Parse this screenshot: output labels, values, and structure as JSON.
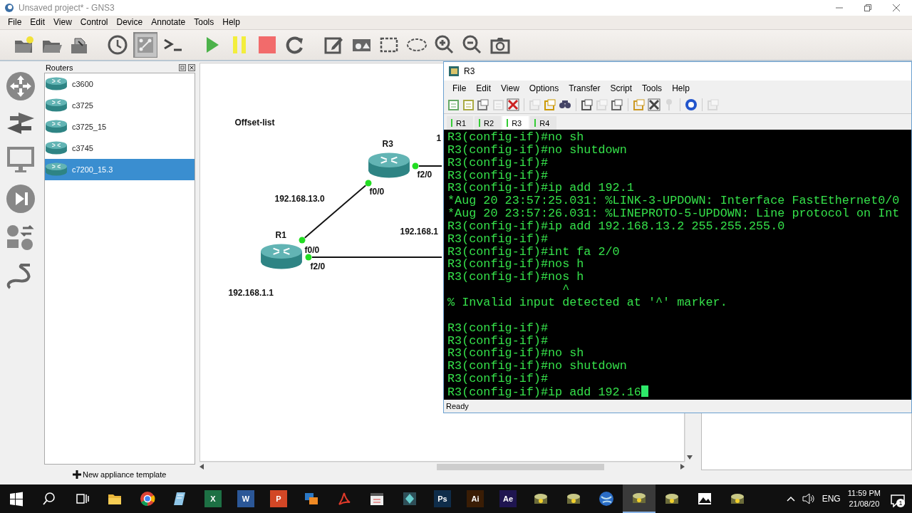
{
  "window": {
    "title": "Unsaved project* - GNS3"
  },
  "menu": [
    "File",
    "Edit",
    "View",
    "Control",
    "Device",
    "Annotate",
    "Tools",
    "Help"
  ],
  "toolbar": [
    {
      "kind": "new-project",
      "on": false
    },
    {
      "kind": "open-project",
      "on": false
    },
    {
      "kind": "save-project",
      "on": false
    },
    {
      "kind": "snapshot",
      "on": false
    },
    {
      "kind": "labels",
      "on": true
    },
    {
      "kind": "console",
      "on": false
    },
    {
      "kind": "start",
      "on": false
    },
    {
      "kind": "suspend",
      "on": false
    },
    {
      "kind": "stop",
      "on": false
    },
    {
      "kind": "reload",
      "on": false
    },
    {
      "kind": "note",
      "on": false
    },
    {
      "kind": "image",
      "on": false
    },
    {
      "kind": "rectangle",
      "on": false
    },
    {
      "kind": "ellipse",
      "on": false
    },
    {
      "kind": "zoom-in",
      "on": false
    },
    {
      "kind": "zoom-out",
      "on": false
    },
    {
      "kind": "screenshot",
      "on": false
    }
  ],
  "routers_panel": {
    "title": "Routers",
    "items": [
      {
        "label": "c3600",
        "selected": false
      },
      {
        "label": "c3725",
        "selected": false
      },
      {
        "label": "c3725_15",
        "selected": false
      },
      {
        "label": "c3745",
        "selected": false
      },
      {
        "label": "c7200_15.3",
        "selected": true
      }
    ],
    "footer": "New appliance template"
  },
  "canvas": {
    "note": "Offset-list",
    "nodes": [
      {
        "name": "R3"
      },
      {
        "name": "R1"
      }
    ],
    "labels": [
      {
        "text": "f2/0"
      },
      {
        "text": "f0/0"
      },
      {
        "text": "192.168.13.0"
      },
      {
        "text": "f0/0"
      },
      {
        "text": "f2/0"
      },
      {
        "text": "192.168.1.1"
      },
      {
        "text": "192.168.1"
      },
      {
        "text": "1"
      }
    ]
  },
  "terminal": {
    "title": "R3",
    "menu": [
      "File",
      "Edit",
      "View",
      "Options",
      "Transfer",
      "Script",
      "Tools",
      "Help"
    ],
    "toolbar": [
      {
        "kind": "connect",
        "disabled": false
      },
      {
        "kind": "quick-connect",
        "disabled": false
      },
      {
        "kind": "folder",
        "disabled": false
      },
      {
        "kind": "reconnect",
        "disabled": true
      },
      {
        "kind": "disconnect",
        "disabled": false
      },
      {
        "kind": "copy",
        "disabled": true
      },
      {
        "kind": "paste",
        "disabled": false
      },
      {
        "kind": "find",
        "disabled": false
      },
      {
        "kind": "print-setup",
        "disabled": false
      },
      {
        "kind": "print-selection",
        "disabled": true
      },
      {
        "kind": "print",
        "disabled": false
      },
      {
        "kind": "options",
        "disabled": false
      },
      {
        "kind": "settings",
        "disabled": false
      },
      {
        "kind": "key",
        "disabled": true
      },
      {
        "kind": "help",
        "disabled": false
      },
      {
        "kind": "window",
        "disabled": true
      }
    ],
    "tabs": [
      {
        "label": "R1",
        "selected": false
      },
      {
        "label": "R2",
        "selected": false
      },
      {
        "label": "R3",
        "selected": true
      },
      {
        "label": "R4",
        "selected": false
      }
    ],
    "lines": [
      {
        "kind": "text",
        "text": "R3(config-if)#no sh"
      },
      {
        "kind": "text",
        "text": "R3(config-if)#no shutdown"
      },
      {
        "kind": "text",
        "text": "R3(config-if)#"
      },
      {
        "kind": "text",
        "text": "R3(config-if)#"
      },
      {
        "kind": "text",
        "text": "R3(config-if)#ip add 192.1"
      },
      {
        "kind": "text",
        "text": "*Aug 20 23:57:25.031: %LINK-3-UPDOWN: Interface FastEthernet0/0"
      },
      {
        "kind": "text",
        "text": "*Aug 20 23:57:26.031: %LINEPROTO-5-UPDOWN: Line protocol on Int"
      },
      {
        "kind": "text",
        "text": "R3(config-if)#ip add 192.168.13.2 255.255.255.0"
      },
      {
        "kind": "text",
        "text": "R3(config-if)#"
      },
      {
        "kind": "text",
        "text": "R3(config-if)#int fa 2/0"
      },
      {
        "kind": "text",
        "text": "R3(config-if)#nos h"
      },
      {
        "kind": "text",
        "text": "R3(config-if)#nos h"
      },
      {
        "kind": "text",
        "text": "                ^"
      },
      {
        "kind": "text",
        "text": "% Invalid input detected at '^' marker."
      },
      {
        "kind": "blank"
      },
      {
        "kind": "text",
        "text": "R3(config-if)#"
      },
      {
        "kind": "text",
        "text": "R3(config-if)#"
      },
      {
        "kind": "text",
        "text": "R3(config-if)#no sh"
      },
      {
        "kind": "text",
        "text": "R3(config-if)#no shutdown"
      },
      {
        "kind": "text",
        "text": "R3(config-if)#"
      },
      {
        "kind": "text",
        "text": "R3(config-if)#ip add 192.16"
      }
    ],
    "cursor": true,
    "status": "Ready"
  },
  "taskbar": {
    "apps": [
      {
        "kind": "start",
        "selected": false
      },
      {
        "kind": "search",
        "selected": false
      },
      {
        "kind": "task-view",
        "selected": false
      },
      {
        "kind": "folder",
        "selected": false
      },
      {
        "kind": "browser",
        "selected": false
      },
      {
        "kind": "notepad",
        "selected": false
      },
      {
        "kind": "tile",
        "label": "X",
        "color": "#1d7044",
        "selected": false
      },
      {
        "kind": "tile",
        "label": "W",
        "color": "#2b5797",
        "selected": false
      },
      {
        "kind": "tile",
        "label": "P",
        "color": "#d24726",
        "selected": false
      },
      {
        "kind": "transfer",
        "selected": false
      },
      {
        "kind": "pdf",
        "selected": false
      },
      {
        "kind": "media",
        "selected": false
      },
      {
        "kind": "diamond",
        "selected": false
      },
      {
        "kind": "tile",
        "label": "Ps",
        "color": "#0f2d4a",
        "selected": false
      },
      {
        "kind": "tile",
        "label": "Ai",
        "color": "#3a1d05",
        "selected": false
      },
      {
        "kind": "tile",
        "label": "Ae",
        "color": "#1f1550",
        "selected": false
      },
      {
        "kind": "router",
        "selected": false
      },
      {
        "kind": "router",
        "selected": false
      },
      {
        "kind": "globe",
        "selected": false
      },
      {
        "kind": "router",
        "selected": true
      },
      {
        "kind": "router",
        "selected": false
      },
      {
        "kind": "photos",
        "selected": false
      },
      {
        "kind": "router",
        "selected": false
      }
    ],
    "language": "ENG",
    "time": "11:59 PM",
    "date": "21/08/20",
    "notifications": "1"
  }
}
